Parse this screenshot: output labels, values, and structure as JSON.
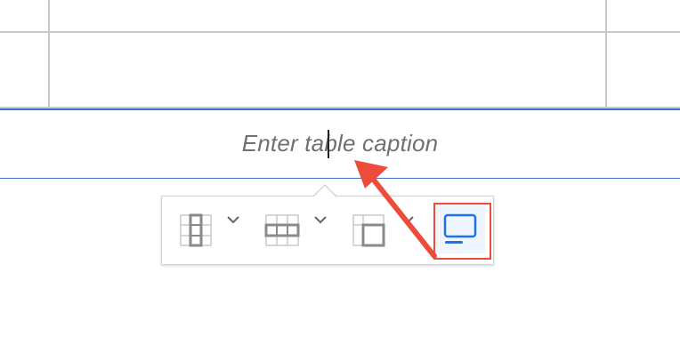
{
  "editor": {
    "caption_placeholder": "Enter table caption"
  },
  "toolbar": {
    "items": [
      {
        "icon": "table-column-icon",
        "has_dropdown": true
      },
      {
        "icon": "table-row-icon",
        "has_dropdown": true
      },
      {
        "icon": "table-merge-cells-icon",
        "has_dropdown": true
      },
      {
        "icon": "toggle-caption-icon",
        "has_dropdown": false,
        "active": true
      }
    ]
  },
  "colors": {
    "selection": "#3f6fd1",
    "active_icon": "#1a73e8",
    "active_bg": "#eef5ff",
    "annotation": "#ee4c3b",
    "caption_text": "#707070"
  }
}
